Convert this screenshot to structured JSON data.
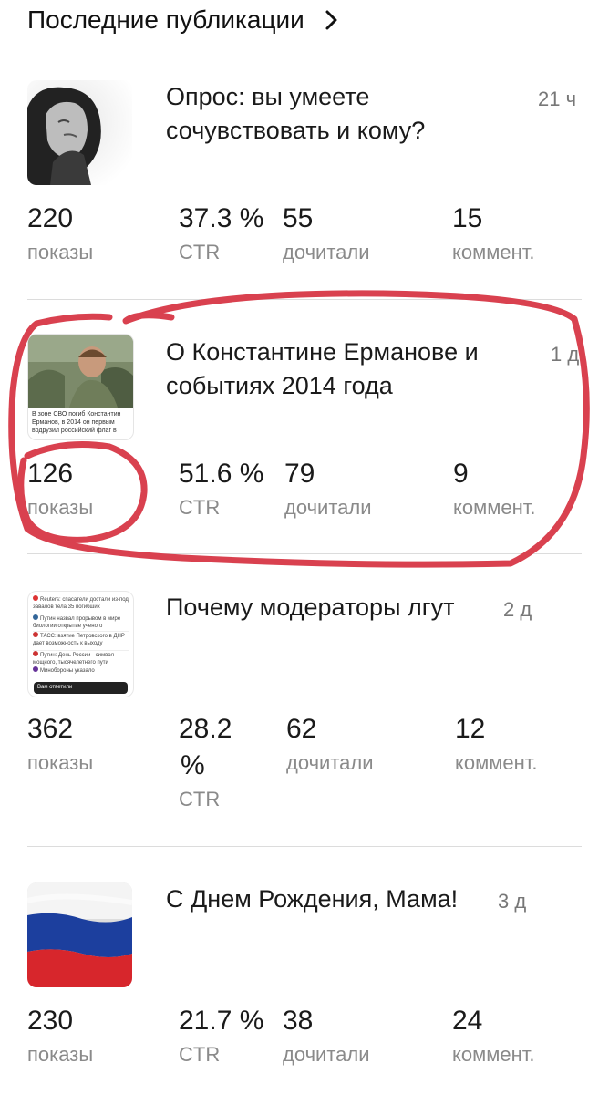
{
  "header": {
    "title": "Последние публикации",
    "chevron_icon": "chevron-right-icon"
  },
  "publications": [
    {
      "title_line1": "Опрос: вы умеете",
      "title_line2": "сочувствовать и кому?",
      "age": "21 ч",
      "stats": {
        "views": "220",
        "views_label": "показы",
        "ctr": "37.3 %",
        "ctr_label": "CTR",
        "reads": "55",
        "reads_label": "дочитали",
        "comments": "15",
        "comments_label": "коммент."
      }
    },
    {
      "title_line1": "О Константине Ерманове и",
      "title_line2": "событиях 2014 года",
      "age": "1 д",
      "thumb_caption": "В зоне СВО погиб Константин Ерманов, в 2014 он первым водрузил российский флаг в",
      "stats": {
        "views": "126",
        "views_label": "показы",
        "ctr": "51.6 %",
        "ctr_label": "CTR",
        "reads": "79",
        "reads_label": "дочитали",
        "comments": "9",
        "comments_label": "коммент."
      }
    },
    {
      "title_line1": "Почему модераторы лгут",
      "title_line2": "",
      "age": "2 д",
      "thumb_lines": [
        "Reuters: спасатели достали из-под завалов тела 35 погибших",
        "Путин назвал прорывом в мире биологии открытие ученого",
        "ТАСС: взятие Петровского в ДНР дает возможность к выходу",
        "Путин: День России - символ мощного, тысячелетнего пути",
        "Минобороны указало",
        "Вам ответили"
      ],
      "stats": {
        "views": "362",
        "views_label": "показы",
        "ctr_line1": "28.2",
        "ctr_line2": "%",
        "ctr_label": "CTR",
        "reads": "62",
        "reads_label": "дочитали",
        "comments": "12",
        "comments_label": "коммент."
      }
    },
    {
      "title_line1": "С Днем Рождения, Мама!",
      "title_line2": "",
      "age": "3 д",
      "stats": {
        "views": "230",
        "views_label": "показы",
        "ctr": "21.7 %",
        "ctr_label": "CTR",
        "reads": "38",
        "reads_label": "дочитали",
        "comments": "24",
        "comments_label": "коммент."
      }
    }
  ],
  "colors": {
    "annotation": "#d9414f",
    "flag_white": "#f4f4f4",
    "flag_blue": "#1c3f9e",
    "flag_red": "#d7262c"
  }
}
